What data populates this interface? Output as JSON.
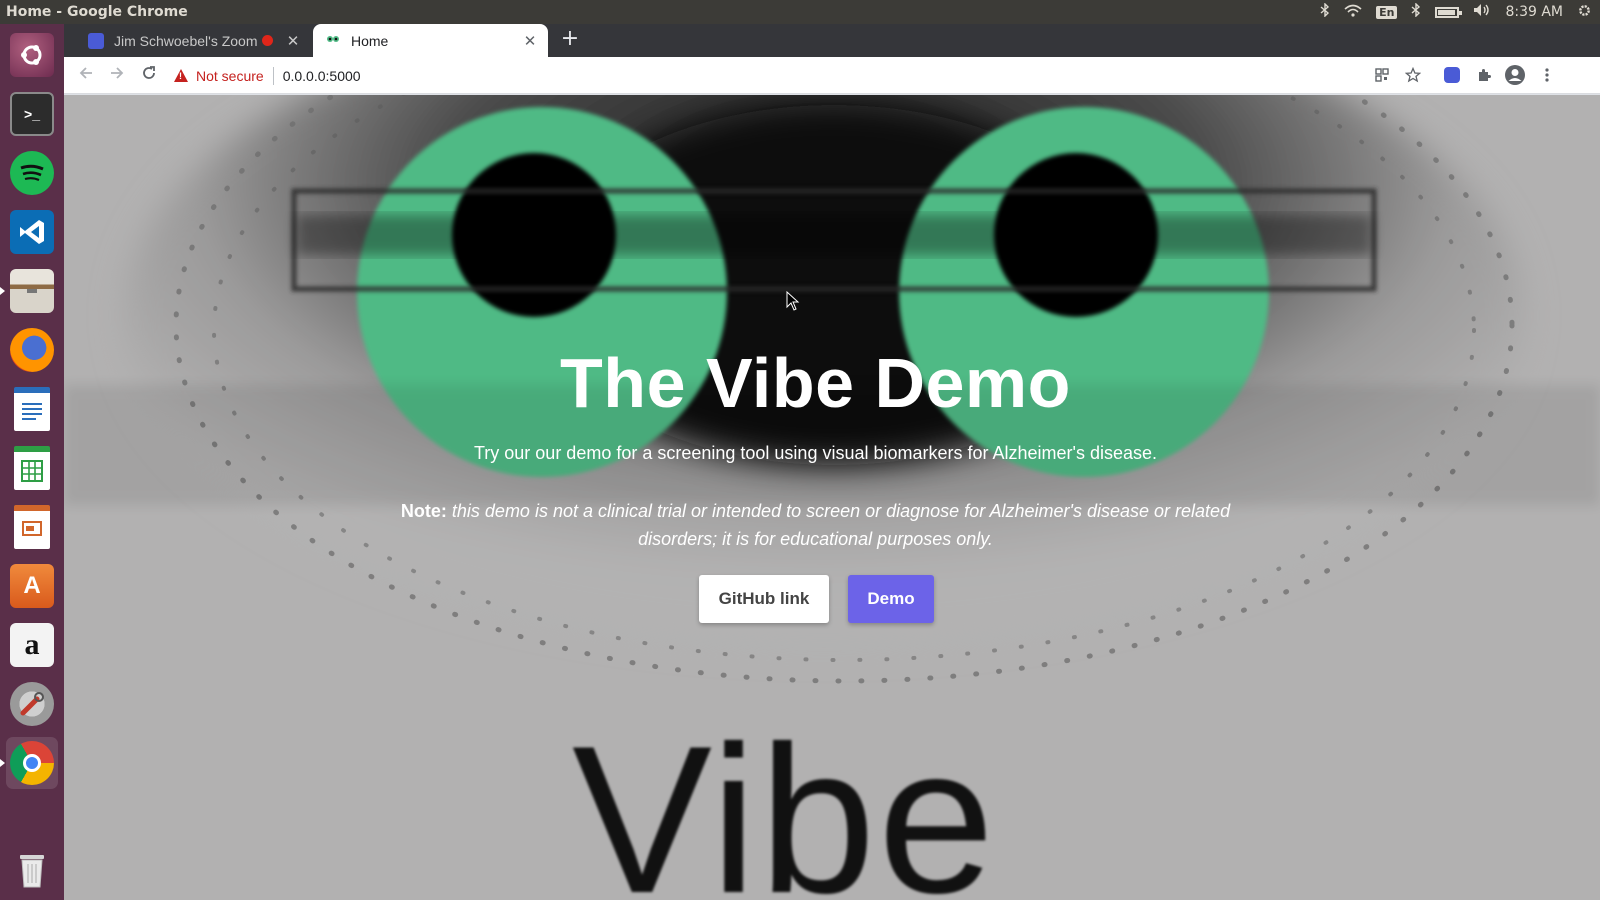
{
  "os": {
    "window_title": "Home - Google Chrome",
    "keyboard_layout": "En",
    "clock": "8:39 AM"
  },
  "launcher": {
    "items": [
      {
        "name": "ubuntu-dash",
        "icon": "ubuntu-logo-icon",
        "color": "#8c3c66"
      },
      {
        "name": "terminal",
        "icon": "terminal-icon",
        "color": "#2c2c2c"
      },
      {
        "name": "spotify",
        "icon": "spotify-icon",
        "color": "#1db954"
      },
      {
        "name": "vscode",
        "icon": "vscode-icon",
        "color": "#0065a9"
      },
      {
        "name": "files",
        "icon": "file-cabinet-icon",
        "color": "#8f8b84"
      },
      {
        "name": "firefox",
        "icon": "firefox-icon",
        "color": "#e66000"
      },
      {
        "name": "writer",
        "icon": "document-icon",
        "color": "#2a6ebb"
      },
      {
        "name": "calc",
        "icon": "spreadsheet-icon",
        "color": "#2e9e45"
      },
      {
        "name": "impress",
        "icon": "presentation-icon",
        "color": "#d1662b"
      },
      {
        "name": "software-center",
        "icon": "shopping-bag-icon",
        "color": "#e9702a"
      },
      {
        "name": "amazon",
        "icon": "amazon-icon",
        "color": "#f3f3f3"
      },
      {
        "name": "settings",
        "icon": "wrench-gear-icon",
        "color": "#b33f3f"
      },
      {
        "name": "chrome",
        "icon": "chrome-icon",
        "color": "#e8e8e8"
      }
    ],
    "trash_icon": "trash-icon"
  },
  "browser": {
    "tabs": [
      {
        "label": "Jim Schwoebel's Zoom",
        "favicon": "zoom-icon",
        "recording": true
      },
      {
        "label": "Home",
        "favicon": "site-icon",
        "active": true
      }
    ],
    "security_label": "Not secure",
    "url": "0.0.0.0:5000"
  },
  "page": {
    "title": "The Vibe Demo",
    "subtitle": "Try our our demo for a screening tool using visual biomarkers for Alzheimer's disease.",
    "note_label": "Note:",
    "note_text": " this demo is not a clinical trial or intended to screen or diagnose for Alzheimer's disease or related disorders; it is for educational purposes only.",
    "buttons": {
      "github": "GitHub link",
      "demo": "Demo"
    },
    "big_word": "Vibe",
    "colors": {
      "iris": "#4fba85",
      "demo_button": "#6c63e8"
    }
  }
}
